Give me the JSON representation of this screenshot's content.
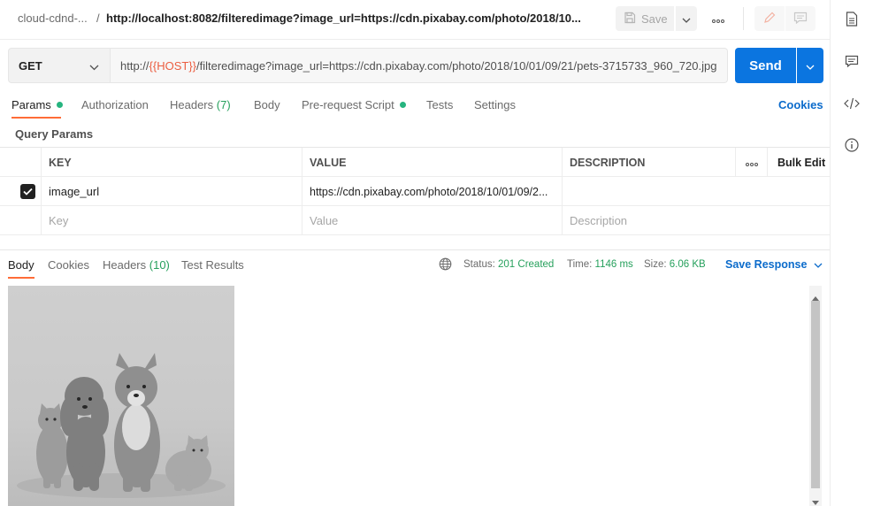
{
  "breadcrumb": {
    "parent": "cloud-cdnd-...",
    "separator": "/",
    "name": "http://localhost:8082/filteredimage?image_url=https://cdn.pixabay.com/photo/2018/10..."
  },
  "toolbar": {
    "save_label": "Save",
    "save_icon": "save-icon",
    "more_icon": "more-horizontal-icon",
    "edit_icon": "pencil-icon",
    "comment_icon": "comment-icon"
  },
  "right_sidebar": {
    "icons": [
      "document-icon",
      "comments-icon",
      "code-icon",
      "info-icon"
    ]
  },
  "request": {
    "method": "GET",
    "url_prefix": "http://",
    "url_var": "{{HOST}}",
    "url_suffix": "/filteredimage?image_url=https://cdn.pixabay.com/photo/2018/10/01/09/21/pets-3715733_960_720.jpg",
    "send_label": "Send"
  },
  "request_tabs": [
    {
      "label": "Params",
      "dot": true
    },
    {
      "label": "Authorization"
    },
    {
      "label": "Headers",
      "count": "(7)"
    },
    {
      "label": "Body"
    },
    {
      "label": "Pre-request Script",
      "dot": true
    },
    {
      "label": "Tests"
    },
    {
      "label": "Settings"
    }
  ],
  "cookies_label": "Cookies",
  "query_params": {
    "title": "Query Params",
    "headers": {
      "key": "KEY",
      "value": "VALUE",
      "description": "DESCRIPTION",
      "bulk_edit": "Bulk Edit"
    },
    "rows": [
      {
        "checked": true,
        "key": "image_url",
        "value": "https://cdn.pixabay.com/photo/2018/10/01/09/2...",
        "description": ""
      }
    ],
    "placeholders": {
      "key": "Key",
      "value": "Value",
      "description": "Description"
    }
  },
  "response": {
    "tabs": [
      {
        "label": "Body"
      },
      {
        "label": "Cookies"
      },
      {
        "label": "Headers",
        "count": "(10)"
      },
      {
        "label": "Test Results"
      }
    ],
    "status_label": "Status:",
    "status_value": "201 Created",
    "time_label": "Time:",
    "time_value": "1146 ms",
    "size_label": "Size:",
    "size_value": "6.06 KB",
    "save_response_label": "Save Response"
  },
  "colors": {
    "accent": "#ff6c37",
    "primary": "#0b75e0",
    "link": "#0b6bcb",
    "success": "#26a05c",
    "variable": "#eb5e41"
  }
}
